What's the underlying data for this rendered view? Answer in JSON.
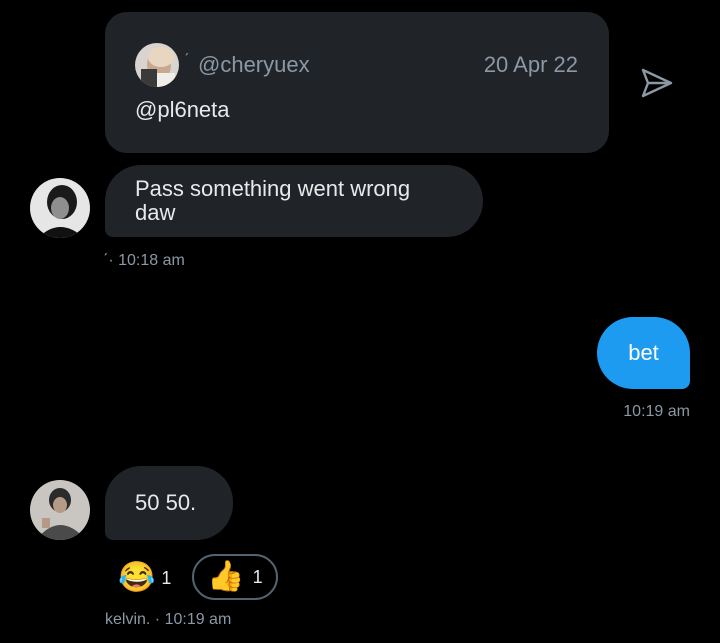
{
  "quote": {
    "tick": "ˊ",
    "handle": "@cheryuex",
    "date": "20 Apr 22",
    "text": "@pl6neta"
  },
  "messages": [
    {
      "direction": "incoming",
      "text": "Pass something went wrong daw",
      "meta": "ˊ· 10:18 am"
    },
    {
      "direction": "outgoing",
      "text": "bet",
      "meta": "10:19 am"
    },
    {
      "direction": "incoming",
      "text": "50 50.",
      "meta": "kelvin. · 10:19 am",
      "reactions": [
        {
          "emoji": "😂",
          "count": "1",
          "icon": "tears-of-joy-emoji"
        },
        {
          "emoji": "👍",
          "count": "1",
          "icon": "thumbs-up-emoji"
        }
      ]
    }
  ],
  "colors": {
    "background": "#000000",
    "bubble_incoming": "#202327",
    "bubble_outgoing": "#1d9bf0",
    "muted_text": "#8b98a5"
  },
  "icons": {
    "share": "send-icon"
  }
}
